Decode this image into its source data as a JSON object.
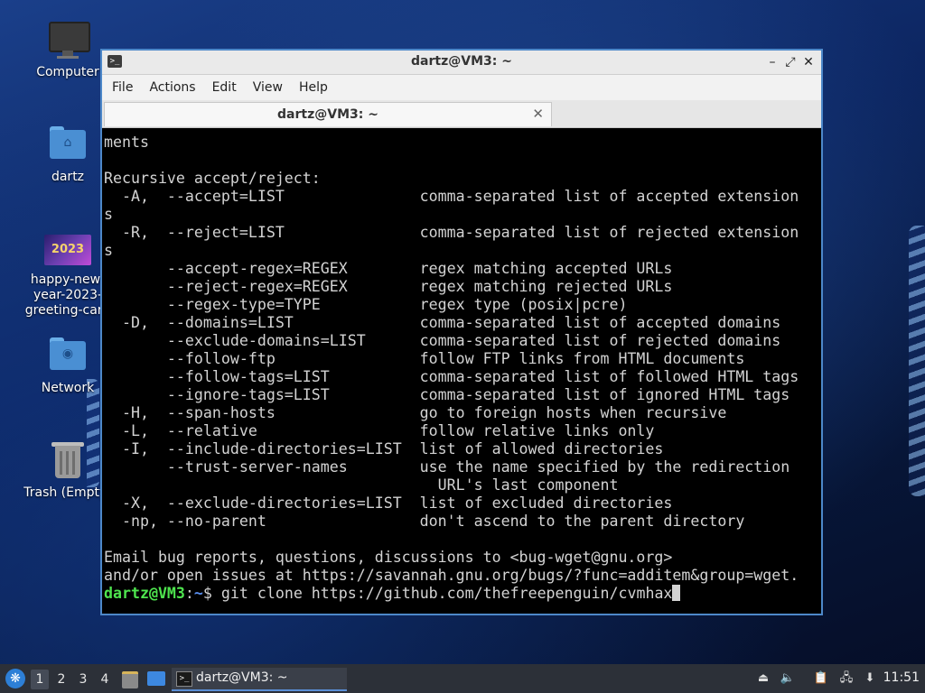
{
  "desktop": {
    "icons": [
      {
        "label": "Computer"
      },
      {
        "label": "dartz"
      },
      {
        "label_lines": [
          "happy-new-",
          "year-2023-",
          "greeting-card"
        ],
        "thumb_text": "2023"
      },
      {
        "label": "Network"
      },
      {
        "label": "Trash (Empty)"
      }
    ]
  },
  "window": {
    "title": "dartz@VM3: ~",
    "menu": [
      "File",
      "Actions",
      "Edit",
      "View",
      "Help"
    ],
    "tab_label": "dartz@VM3: ~",
    "controls": {
      "minimize": "–",
      "maximize": "⤢",
      "close": "✕"
    },
    "terminal": {
      "lines": [
        "ments",
        "",
        "Recursive accept/reject:",
        "  -A,  --accept=LIST               comma-separated list of accepted extension",
        "s",
        "  -R,  --reject=LIST               comma-separated list of rejected extension",
        "s",
        "       --accept-regex=REGEX        regex matching accepted URLs",
        "       --reject-regex=REGEX        regex matching rejected URLs",
        "       --regex-type=TYPE           regex type (posix|pcre)",
        "  -D,  --domains=LIST              comma-separated list of accepted domains",
        "       --exclude-domains=LIST      comma-separated list of rejected domains",
        "       --follow-ftp                follow FTP links from HTML documents",
        "       --follow-tags=LIST          comma-separated list of followed HTML tags",
        "       --ignore-tags=LIST          comma-separated list of ignored HTML tags",
        "  -H,  --span-hosts                go to foreign hosts when recursive",
        "  -L,  --relative                  follow relative links only",
        "  -I,  --include-directories=LIST  list of allowed directories",
        "       --trust-server-names        use the name specified by the redirection",
        "                                     URL's last component",
        "  -X,  --exclude-directories=LIST  list of excluded directories",
        "  -np, --no-parent                 don't ascend to the parent directory",
        "",
        "Email bug reports, questions, discussions to <bug-wget@gnu.org>",
        "and/or open issues at https://savannah.gnu.org/bugs/?func=additem&group=wget."
      ],
      "prompt_user": "dartz@VM3",
      "prompt_sep": ":",
      "prompt_path": "~",
      "prompt_symbol": "$ ",
      "command": "git clone https://github.com/thefreepenguin/cvmhax"
    }
  },
  "taskbar": {
    "workspaces": [
      "1",
      "2",
      "3",
      "4"
    ],
    "active_workspace": "1",
    "task_label": "dartz@VM3: ~",
    "clock": "11:51"
  }
}
